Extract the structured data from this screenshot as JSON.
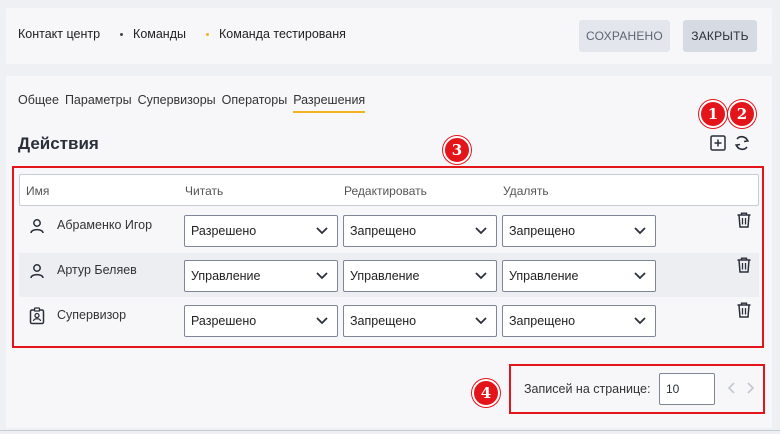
{
  "breadcrumb": {
    "items": [
      "Контакт центр",
      "Команды",
      "Команда тестированя"
    ]
  },
  "header": {
    "saved_label": "СОХРАНЕНО",
    "close_label": "ЗАКРЫТЬ"
  },
  "tabs": [
    {
      "label": "Общее"
    },
    {
      "label": "Параметры"
    },
    {
      "label": "Супервизоры"
    },
    {
      "label": "Операторы"
    },
    {
      "label": "Разрешения",
      "active": true
    }
  ],
  "section": {
    "title": "Действия"
  },
  "callouts": [
    "1",
    "2",
    "3",
    "4"
  ],
  "table": {
    "columns": [
      "Имя",
      "Читать",
      "Редактировать",
      "Удалять"
    ],
    "rows": [
      {
        "name": "Абраменко Игор",
        "icon": "user-icon",
        "read": "Разрешено",
        "edit": "Запрещено",
        "delete": "Запрещено"
      },
      {
        "name": "Артур Беляев",
        "icon": "user-icon",
        "read": "Управление",
        "edit": "Управление",
        "delete": "Управление"
      },
      {
        "name": "Супервизор",
        "icon": "badge-icon",
        "read": "Разрешено",
        "edit": "Запрещено",
        "delete": "Запрещено"
      }
    ]
  },
  "pagination": {
    "label": "Записей на странице:",
    "page_size": "10"
  },
  "colors": {
    "accent": "#f0b323",
    "callout": "#e4141b"
  }
}
